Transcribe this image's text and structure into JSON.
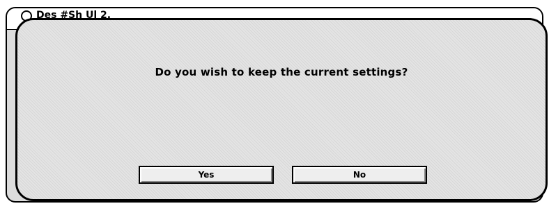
{
  "background_window": {
    "title": "Des #Sh Ul 2."
  },
  "dialog": {
    "message": "Do you wish to keep the current settings?",
    "yes_label": "Yes",
    "no_label": "No"
  }
}
